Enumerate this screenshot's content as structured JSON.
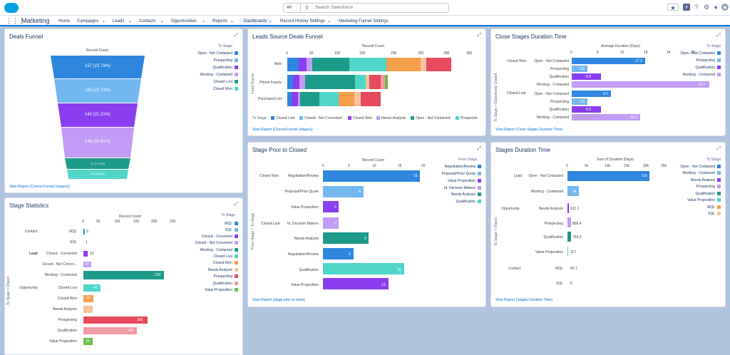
{
  "app": {
    "name": "Marketing"
  },
  "search": {
    "scope": "All",
    "placeholder": "Search Salesforce"
  },
  "nav": [
    "Home",
    "Campaigns",
    "Leads",
    "Contacts",
    "Opportunities",
    "Reports",
    "Dashboards",
    "Record History Settings",
    "Marketing Funnel Settings"
  ],
  "colors": {
    "blue": "#2e86de",
    "lightblue": "#72b7f0",
    "purple": "#8b3df0",
    "lavender": "#c19bf5",
    "teal": "#1d9b8a",
    "cyan": "#4fd6c9",
    "orange": "#f59e4b",
    "peach": "#f8c49c",
    "red": "#e64a5c",
    "pink": "#f19aa3",
    "green": "#6cbf4a"
  },
  "deals_funnel": {
    "title": "Deals Funnel",
    "subtitle": "Record Count",
    "legend_title": "To Stage",
    "legend": [
      "Open - Not Contacted",
      "Prospecting",
      "Qualification",
      "Working - Contacted",
      "Closed Lost",
      "Closed Won"
    ],
    "segments": [
      "157 (23.79%)",
      "150 (22.73%)",
      "140 (21.21%)",
      "136 (20.61%)",
      "47 (7.12%)",
      "30 (4.55%)"
    ],
    "link": "View Report (Current Funnel (stages))"
  },
  "leads_source": {
    "title": "Leads Source Deals Funnel",
    "subtitle": "Record Count",
    "ticks": [
      "0",
      "50",
      "100",
      "150",
      "200",
      "250",
      "300",
      "350"
    ],
    "y_axis": "Lead Source",
    "rows": [
      "Web",
      "Phone Inquiry",
      "Purchased List"
    ],
    "legend_title": "To Stage",
    "legend": [
      "Closed Lost",
      "Closed - Not Converted",
      "Closed Won",
      "Needs Analysis",
      "Open - Not Contacted",
      "Prospectin"
    ],
    "link": "View Report (Current Funnel (stages))"
  },
  "close_stages": {
    "title": "Close Stages Duration Time",
    "subtitle": "Average Duration (Days)",
    "ticks": [
      "0",
      "6",
      "12",
      "18",
      "24",
      "30",
      "3("
    ],
    "y_axis": "To Stage > Opportunity Closed",
    "groups": [
      "Closed Won",
      "Closed Lost"
    ],
    "rows": [
      {
        "stage": "Open - Not Contacted",
        "value": "17.3"
      },
      {
        "stage": "Prospecting",
        "value": "3.6"
      },
      {
        "stage": "Qualification",
        "value": "6.9"
      },
      {
        "stage": "Working - Contacted",
        "value": "32.3"
      },
      {
        "stage": "Open - Not Contacted",
        "value": "9.2"
      },
      {
        "stage": "Prospecting",
        "value": "3.6"
      },
      {
        "stage": "Qualification",
        "value": "6.9"
      },
      {
        "stage": "Working - Contacted",
        "value": "16.1"
      }
    ],
    "legend_title": "To Stage",
    "legend": [
      "Open - Not Contacted",
      "Prospecting",
      "Qualification",
      "Working - Contacted"
    ],
    "link": "View Report (Close Stages Duration Time)"
  },
  "stage_prior": {
    "title": "Stage Prior to Closed",
    "subtitle": "Record Count",
    "ticks": [
      "0",
      "5",
      "10",
      "15",
      "20"
    ],
    "y_axis": "From Stage > To Stage",
    "groups": [
      "Closed Won",
      "Closed Lost"
    ],
    "rows": [
      {
        "stage": "Negotiation/Review",
        "value": "19"
      },
      {
        "stage": "Proposal/Price Quote",
        "value": "8"
      },
      {
        "stage": "Value Proposition",
        "value": "3"
      },
      {
        "stage": "Id. Decision Makers",
        "value": "3"
      },
      {
        "stage": "Needs Analysis",
        "value": "9"
      },
      {
        "stage": "Negotiation/Review",
        "value": "6"
      },
      {
        "stage": "Qualification",
        "value": "16"
      },
      {
        "stage": "Value Proposition",
        "value": "13"
      }
    ],
    "legend_title": "From Stage",
    "legend": [
      "Negotiation/Review",
      "Proposal/Price Quote",
      "Value Proposition",
      "Id. Decision Makers",
      "Needs Analysis",
      "Qualification"
    ],
    "link": "View Report (stage prior to close)"
  },
  "stages_duration": {
    "title": "Stages Duration Time",
    "subtitle": "Sum of Duration (Days)",
    "ticks": [
      "0",
      "5k",
      "10k",
      "15k",
      "20k",
      "25k"
    ],
    "y_axis": "To Stage > Object",
    "rows": [
      {
        "group": "Lead",
        "stage": "Open - Not Contacted",
        "value": "21k"
      },
      {
        "group": "",
        "stage": "Working - Contacted",
        "value": "3k"
      },
      {
        "group": "Opportunity",
        "stage": "Needs Analysis",
        "value": "121.1"
      },
      {
        "group": "",
        "stage": "Prospecting",
        "value": "868.4"
      },
      {
        "group": "",
        "stage": "Qualification",
        "value": "769.3"
      },
      {
        "group": "",
        "stage": "Value Proposition",
        "value": "117"
      },
      {
        "group": "Contact",
        "stage": "MQL",
        "value": "65.7"
      },
      {
        "group": "",
        "stage": "SQL",
        "value": "0"
      }
    ],
    "legend_title": "To Stage",
    "legend": [
      "Open - Not Contacted",
      "Working - Contacted",
      "Needs Analysis",
      "Prospecting",
      "Qualification",
      "Value Proposition",
      "MQL",
      "SQL"
    ],
    "link": "View Report (Stages Duration Time)"
  },
  "stage_stats": {
    "title": "Stage Statistics",
    "subtitle": "Record Count",
    "ticks": [
      "0",
      "50",
      "100",
      "150",
      "200",
      "250"
    ],
    "y_axis": "To Stage > Object",
    "rows": [
      {
        "group": "Contact",
        "stage": "MQL",
        "value": "3"
      },
      {
        "group": "",
        "stage": "SQL",
        "value": "1"
      },
      {
        "group": "Lead",
        "stage": "Closed - Converted",
        "value": "13"
      },
      {
        "group": "",
        "stage": "Closed - Not Conver...",
        "value": "24"
      },
      {
        "group": "",
        "stage": "Working - Contacted",
        "value": "210"
      },
      {
        "group": "Opportunity",
        "stage": "Closed Lost",
        "value": "47"
      },
      {
        "group": "",
        "stage": "Closed Won",
        "value": "30"
      },
      {
        "group": "",
        "stage": "Needs Analysis",
        "value": ""
      },
      {
        "group": "",
        "stage": "Prospecting",
        "value": "166"
      },
      {
        "group": "",
        "stage": "Qualification",
        "value": "140"
      },
      {
        "group": "",
        "stage": "Value Proposition",
        "value": "29"
      }
    ],
    "legend_title": "To Stage",
    "legend": [
      "MQL",
      "SQL",
      "Closed - Converted",
      "Closed - Not Converted",
      "Working - Contacted",
      "Closed Lost",
      "Closed Won",
      "Needs Analysis",
      "Prospecting",
      "Qualification",
      "Value Proposition"
    ]
  }
}
